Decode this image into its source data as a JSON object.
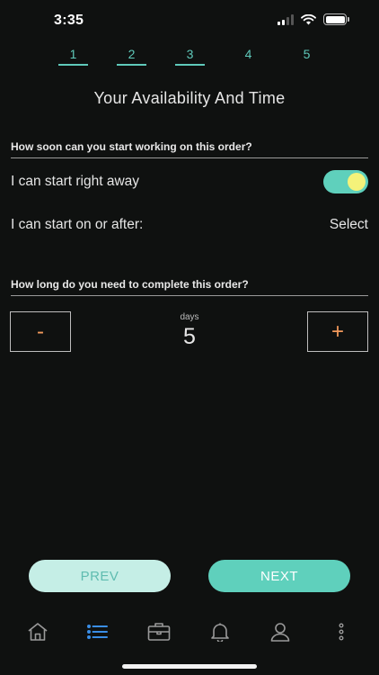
{
  "status": {
    "time": "3:35"
  },
  "steps": [
    {
      "label": "1",
      "done": true
    },
    {
      "label": "2",
      "done": true
    },
    {
      "label": "3",
      "done": true
    },
    {
      "label": "4",
      "done": false
    },
    {
      "label": "5",
      "done": false
    }
  ],
  "page": {
    "title": "Your Availability And Time"
  },
  "start_section": {
    "question": "How soon can you start working on this order?",
    "start_right_away_label": "I can start right away",
    "start_right_away_on": true,
    "start_after_label": "I can start on or after:",
    "start_after_value": "Select"
  },
  "duration_section": {
    "question": "How long do you need to complete this order?",
    "decrement_label": "-",
    "increment_label": "+",
    "unit_label": "days",
    "value": "5"
  },
  "buttons": {
    "prev": "PREV",
    "next": "NEXT"
  },
  "tabbar": {
    "items": [
      {
        "icon": "home-icon",
        "active": false
      },
      {
        "icon": "list-icon",
        "active": true
      },
      {
        "icon": "briefcase-icon",
        "active": false
      },
      {
        "icon": "bell-icon",
        "active": false
      },
      {
        "icon": "profile-icon",
        "active": false
      },
      {
        "icon": "more-icon",
        "active": false
      }
    ]
  },
  "colors": {
    "accent": "#5fd0bc",
    "active_tab": "#3a8ee6",
    "stepper_sign": "#f39a5c",
    "toggle_knob": "#f4f27a"
  }
}
